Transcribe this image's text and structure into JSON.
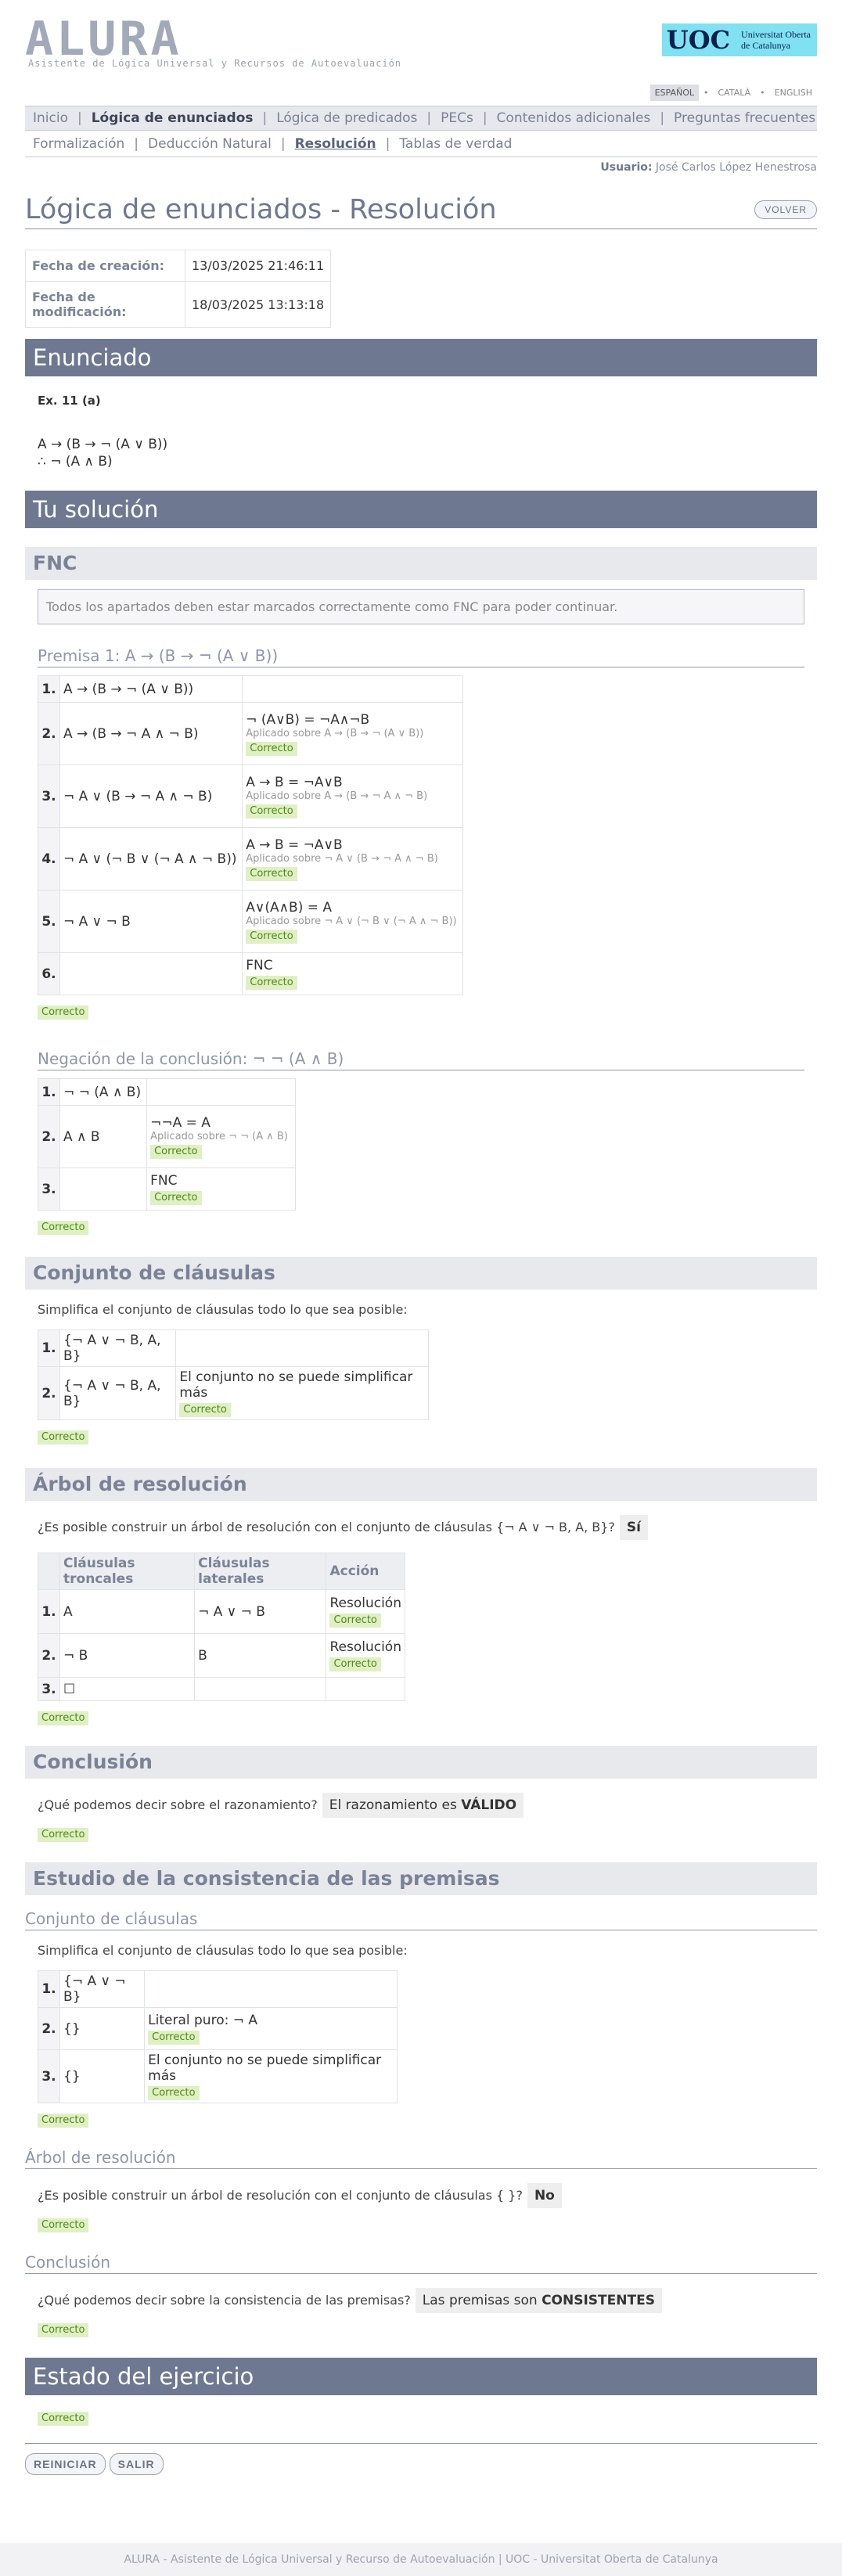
{
  "app": {
    "logo_text": "ALURA",
    "logo_subtitle": "Asistente de Lógica Universal y Recursos de Autoevaluación",
    "uoc_mark": "UOC",
    "uoc_name_1": "Universitat Oberta",
    "uoc_name_2": "de Catalunya"
  },
  "languages": [
    "ESPAÑOL",
    "CATALÀ",
    "ENGLISH"
  ],
  "mainnav": [
    "Inicio",
    "Lógica de enunciados",
    "Lógica de predicados",
    "PECs",
    "Contenidos adicionales",
    "Preguntas frecuentes"
  ],
  "subnav": [
    "Formalización",
    "Deducción Natural",
    "Resolución",
    "Tablas de verdad"
  ],
  "user": {
    "label": "Usuario:",
    "name": "José Carlos López Henestrosa"
  },
  "title": "Lógica de enunciados - Resolución",
  "back_button": "VOLVER",
  "dates": {
    "created_label": "Fecha de creación:",
    "created_value": "13/03/2025 21:46:11",
    "modified_label": "Fecha de modificación:",
    "modified_value": "18/03/2025 13:13:18"
  },
  "enunciado": {
    "heading": "Enunciado",
    "ex": "Ex. 11 (a)",
    "premise": "A → (B → ¬ (A ∨ B))",
    "conclusion": "∴ ¬ (A ∧ B)"
  },
  "solution_heading": "Tu solución",
  "fnc": {
    "heading": "FNC",
    "warning": "Todos los apartados deben estar marcados correctamente como FNC para poder continuar.",
    "premise_title": "Premisa 1: A → (B → ¬ (A ∨ B))",
    "premise_rows": [
      {
        "n": "1.",
        "f": "A → (B → ¬ (A ∨ B))",
        "rule": "",
        "applied": "",
        "tag": ""
      },
      {
        "n": "2.",
        "f": "A → (B → ¬ A ∧ ¬ B)",
        "rule": "¬ (A∨B) = ¬A∧¬B",
        "applied": "Aplicado sobre A → (B → ¬ (A ∨ B))",
        "tag": "Correcto"
      },
      {
        "n": "3.",
        "f": "¬ A ∨ (B → ¬ A ∧ ¬ B)",
        "rule": "A → B = ¬A∨B",
        "applied": "Aplicado sobre A → (B → ¬ A ∧ ¬ B)",
        "tag": "Correcto"
      },
      {
        "n": "4.",
        "f": "¬ A ∨ (¬ B ∨ (¬ A ∧ ¬ B))",
        "rule": "A → B = ¬A∨B",
        "applied": "Aplicado sobre ¬ A ∨ (B → ¬ A ∧ ¬ B)",
        "tag": "Correcto"
      },
      {
        "n": "5.",
        "f": "¬ A ∨ ¬ B",
        "rule": "A∨(A∧B) = A",
        "applied": "Aplicado sobre ¬ A ∨ (¬ B ∨ (¬ A ∧ ¬ B))",
        "tag": "Correcto"
      },
      {
        "n": "6.",
        "f": "",
        "rule": "FNC",
        "applied": "",
        "tag": "Correcto"
      }
    ],
    "premise_result": "Correcto",
    "negation_title": "Negación de la conclusión: ¬ ¬ (A ∧ B)",
    "negation_rows": [
      {
        "n": "1.",
        "f": "¬ ¬ (A ∧ B)",
        "rule": "",
        "applied": "",
        "tag": ""
      },
      {
        "n": "2.",
        "f": "A ∧ B",
        "rule": "¬¬A = A",
        "applied": "Aplicado sobre ¬ ¬ (A ∧ B)",
        "tag": "Correcto"
      },
      {
        "n": "3.",
        "f": "",
        "rule": "FNC",
        "applied": "",
        "tag": "Correcto"
      }
    ],
    "negation_result": "Correcto"
  },
  "clauses": {
    "heading": "Conjunto de cláusulas",
    "instruction": "Simplifica el conjunto de cláusulas todo lo que sea posible:",
    "rows": [
      {
        "n": "1.",
        "f": "{¬ A ∨ ¬ B, A, B}",
        "note": "",
        "tag": ""
      },
      {
        "n": "2.",
        "f": "{¬ A ∨ ¬ B, A, B}",
        "note": "El conjunto no se puede simplificar más",
        "tag": "Correcto"
      }
    ],
    "result": "Correcto"
  },
  "tree": {
    "heading": "Árbol de resolución",
    "question": "¿Es posible construir un árbol de resolución con el conjunto de cláusulas {¬ A ∨ ¬ B, A, B}?",
    "answer": "Sí",
    "columns": [
      "Cláusulas troncales",
      "Cláusulas laterales",
      "Acción"
    ],
    "rows": [
      {
        "n": "1.",
        "trunk": "A",
        "lateral": "¬ A ∨ ¬ B",
        "action": "Resolución",
        "tag": "Correcto"
      },
      {
        "n": "2.",
        "trunk": "¬ B",
        "lateral": "B",
        "action": "Resolución",
        "tag": "Correcto"
      },
      {
        "n": "3.",
        "trunk": "☐",
        "lateral": "",
        "action": "",
        "tag": ""
      }
    ],
    "result": "Correcto"
  },
  "conclusion": {
    "heading": "Conclusión",
    "question": "¿Qué podemos decir sobre el razonamiento?",
    "answer_prefix": "El razonamiento es",
    "answer_strong": "VÁLIDO",
    "result": "Correcto"
  },
  "consistency": {
    "heading": "Estudio de la consistencia de las premisas",
    "clauses_title": "Conjunto de cláusulas",
    "instruction": "Simplifica el conjunto de cláusulas todo lo que sea posible:",
    "rows": [
      {
        "n": "1.",
        "f": "{¬ A ∨ ¬ B}",
        "note": "",
        "tag": ""
      },
      {
        "n": "2.",
        "f": "{}",
        "note": "Literal puro: ¬ A",
        "tag": "Correcto"
      },
      {
        "n": "3.",
        "f": "{}",
        "note": "El conjunto no se puede simplificar más",
        "tag": "Correcto"
      }
    ],
    "clauses_result": "Correcto",
    "tree_title": "Árbol de resolución",
    "tree_question": "¿Es posible construir un árbol de resolución con el conjunto de cláusulas { }?",
    "tree_answer": "No",
    "tree_result": "Correcto",
    "concl_title": "Conclusión",
    "concl_question": "¿Qué podemos decir sobre la consistencia de las premisas?",
    "concl_answer_prefix": "Las premisas son",
    "concl_answer_strong": "CONSISTENTES",
    "concl_result": "Correcto"
  },
  "state": {
    "heading": "Estado del ejercicio",
    "result": "Correcto"
  },
  "actions": {
    "reset": "REINICIAR",
    "exit": "SALIR"
  },
  "footer": "ALURA - Asistente de Lógica Universal y Recurso de Autoevaluación | UOC - Universitat Oberta de Catalunya"
}
